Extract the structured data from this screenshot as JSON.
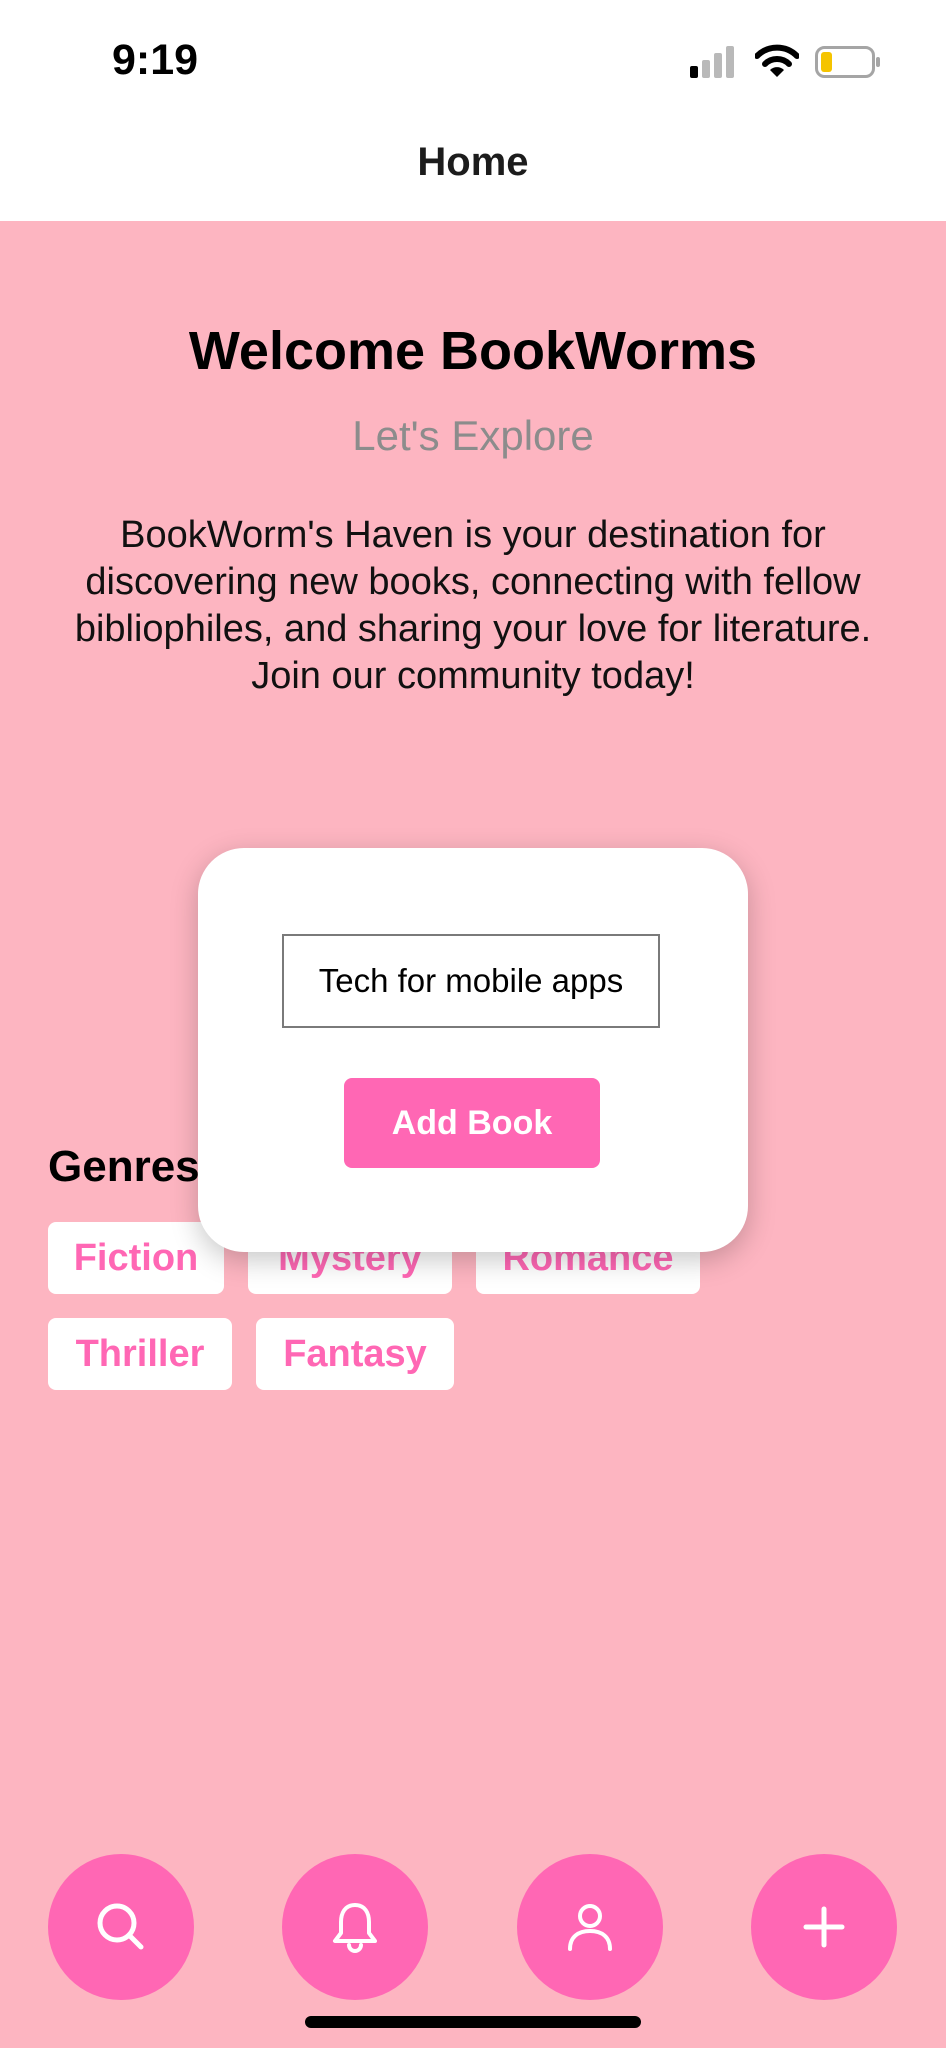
{
  "status_bar": {
    "time": "9:19"
  },
  "nav": {
    "title": "Home"
  },
  "hero": {
    "title": "Welcome BookWorms",
    "subtitle": "Let's Explore",
    "description": "BookWorm's Haven is your destination for discovering new books, connecting with fellow bibliophiles, and sharing your love for literature. Join our community today!"
  },
  "genres": {
    "title": "Genres",
    "items": [
      "Fiction",
      "Mystery",
      "Romance",
      "Thriller",
      "Fantasy"
    ]
  },
  "modal": {
    "input_value": "Tech for mobile apps",
    "button_label": "Add Book"
  },
  "bottom_actions": [
    "search-icon",
    "bell-icon",
    "person-icon",
    "plus-icon"
  ],
  "colors": {
    "background": "#fdb5c1",
    "accent": "#ff67b4",
    "battery": "#f5c400"
  }
}
